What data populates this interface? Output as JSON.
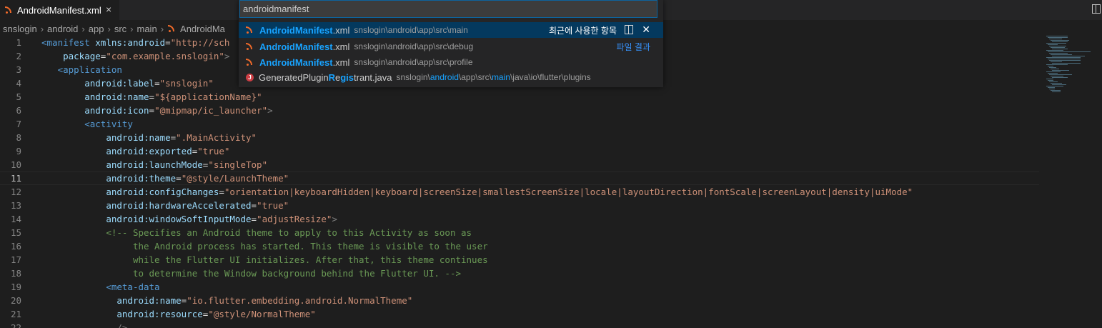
{
  "tab": {
    "title": "AndroidManifest.xml",
    "close": "×"
  },
  "breadcrumb": [
    "snslogin",
    "android",
    "app",
    "src",
    "main",
    "AndroidMa"
  ],
  "picker": {
    "query": "androidmanifest",
    "recent_label": "최근에 사용한 항목",
    "files_label": "파일 결과",
    "items": [
      {
        "pre": "",
        "match": "AndroidManifest",
        "post": ".xml",
        "path": "snslogin\\android\\app\\src\\main",
        "icon": "rss-xml-icon"
      },
      {
        "pre": "",
        "match": "AndroidManifest",
        "post": ".xml",
        "path": "snslogin\\android\\app\\src\\debug",
        "icon": "rss-xml-icon"
      },
      {
        "pre": "",
        "match": "AndroidManifest",
        "post": ".xml",
        "path": "snslogin\\android\\app\\src\\profile",
        "icon": "rss-xml-icon"
      },
      {
        "name_parts": [
          "Generated",
          "P",
          "lugin",
          "R",
          "e",
          "gis",
          "t",
          "rant.java"
        ],
        "path_parts": [
          "snslogin\\",
          "android",
          "\\app\\src\\",
          "main",
          "\\java\\io\\flutter\\plugins"
        ],
        "icon": "java-icon"
      }
    ]
  },
  "editor": {
    "active_line": 11,
    "lines": [
      [
        [
          "tag",
          "<manifest "
        ],
        [
          "attr",
          "xmlns:android"
        ],
        [
          "txt",
          "="
        ],
        [
          "str",
          "\"http://sch"
        ]
      ],
      [
        [
          "txt",
          "    "
        ],
        [
          "attr",
          "package"
        ],
        [
          "txt",
          "="
        ],
        [
          "str",
          "\"com.example.snslogin\""
        ],
        [
          "pun",
          ">"
        ]
      ],
      [
        [
          "txt",
          "   "
        ],
        [
          "tag",
          "<application"
        ]
      ],
      [
        [
          "txt",
          "        "
        ],
        [
          "attr",
          "android:label"
        ],
        [
          "txt",
          "="
        ],
        [
          "str",
          "\"snslogin\""
        ]
      ],
      [
        [
          "txt",
          "        "
        ],
        [
          "attr",
          "android:name"
        ],
        [
          "txt",
          "="
        ],
        [
          "str",
          "\"${applicationName}\""
        ]
      ],
      [
        [
          "txt",
          "        "
        ],
        [
          "attr",
          "android:icon"
        ],
        [
          "txt",
          "="
        ],
        [
          "str",
          "\"@mipmap/ic_launcher\""
        ],
        [
          "pun",
          ">"
        ]
      ],
      [
        [
          "txt",
          "        "
        ],
        [
          "tag",
          "<activity"
        ]
      ],
      [
        [
          "txt",
          "            "
        ],
        [
          "attr",
          "android:name"
        ],
        [
          "txt",
          "="
        ],
        [
          "str",
          "\".MainActivity\""
        ]
      ],
      [
        [
          "txt",
          "            "
        ],
        [
          "attr",
          "android:exported"
        ],
        [
          "txt",
          "="
        ],
        [
          "str",
          "\"true\""
        ]
      ],
      [
        [
          "txt",
          "            "
        ],
        [
          "attr",
          "android:launchMode"
        ],
        [
          "txt",
          "="
        ],
        [
          "str",
          "\"singleTop\""
        ]
      ],
      [
        [
          "txt",
          "            "
        ],
        [
          "attr",
          "android:theme"
        ],
        [
          "txt",
          "="
        ],
        [
          "str",
          "\"@style/LaunchTheme\""
        ]
      ],
      [
        [
          "txt",
          "            "
        ],
        [
          "attr",
          "android:configChanges"
        ],
        [
          "txt",
          "="
        ],
        [
          "str",
          "\"orientation|keyboardHidden|keyboard|screenSize|smallestScreenSize|locale|layoutDirection|fontScale|screenLayout|density|uiMode\""
        ]
      ],
      [
        [
          "txt",
          "            "
        ],
        [
          "attr",
          "android:hardwareAccelerated"
        ],
        [
          "txt",
          "="
        ],
        [
          "str",
          "\"true\""
        ]
      ],
      [
        [
          "txt",
          "            "
        ],
        [
          "attr",
          "android:windowSoftInputMode"
        ],
        [
          "txt",
          "="
        ],
        [
          "str",
          "\"adjustResize\""
        ],
        [
          "pun",
          ">"
        ]
      ],
      [
        [
          "txt",
          "            "
        ],
        [
          "cmt",
          "<!-- Specifies an Android theme to apply to this Activity as soon as"
        ]
      ],
      [
        [
          "txt",
          "                 "
        ],
        [
          "cmt",
          "the Android process has started. This theme is visible to the user"
        ]
      ],
      [
        [
          "txt",
          "                 "
        ],
        [
          "cmt",
          "while the Flutter UI initializes. After that, this theme continues"
        ]
      ],
      [
        [
          "txt",
          "                 "
        ],
        [
          "cmt",
          "to determine the Window background behind the Flutter UI. -->"
        ]
      ],
      [
        [
          "txt",
          "            "
        ],
        [
          "tag",
          "<meta-data"
        ]
      ],
      [
        [
          "txt",
          "              "
        ],
        [
          "attr",
          "android:name"
        ],
        [
          "txt",
          "="
        ],
        [
          "str",
          "\"io.flutter.embedding.android.NormalTheme\""
        ]
      ],
      [
        [
          "txt",
          "              "
        ],
        [
          "attr",
          "android:resource"
        ],
        [
          "txt",
          "="
        ],
        [
          "str",
          "\"@style/NormalTheme\""
        ]
      ],
      [
        [
          "txt",
          "              "
        ],
        [
          "pun",
          "/>"
        ]
      ]
    ]
  }
}
